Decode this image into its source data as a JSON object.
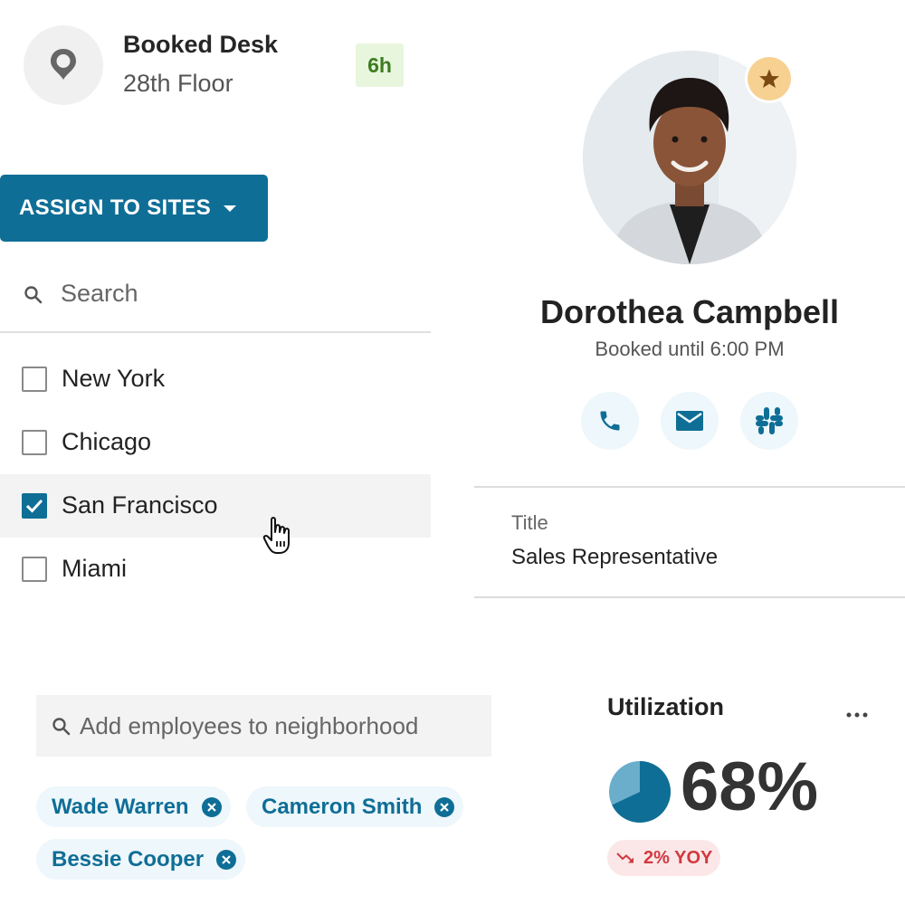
{
  "desk": {
    "title": "Booked Desk",
    "subtitle": "28th Floor",
    "duration_badge": "6h",
    "icon": "location-pin-icon"
  },
  "assign": {
    "label": "ASSIGN TO SITES",
    "accent": "#0f6e96"
  },
  "site_search": {
    "placeholder": "Search"
  },
  "sites": [
    {
      "label": "New York",
      "checked": false
    },
    {
      "label": "Chicago",
      "checked": false
    },
    {
      "label": "San Francisco",
      "checked": true
    },
    {
      "label": "Miami",
      "checked": false
    }
  ],
  "profile": {
    "name": "Dorothea Campbell",
    "booked": "Booked until 6:00 PM",
    "badge_icon": "star-icon",
    "contacts": [
      "phone-icon",
      "email-icon",
      "slack-icon"
    ],
    "title_label": "Title",
    "title_value": "Sales Representative"
  },
  "employees": {
    "placeholder": "Add employees to neighborhood",
    "chips": [
      "Wade Warren",
      "Cameron Smith",
      "Bessie Cooper"
    ]
  },
  "utilization": {
    "title": "Utilization",
    "value": "68%",
    "percent": 68,
    "trend": "2% YOY",
    "trend_color": "#d0393f"
  }
}
